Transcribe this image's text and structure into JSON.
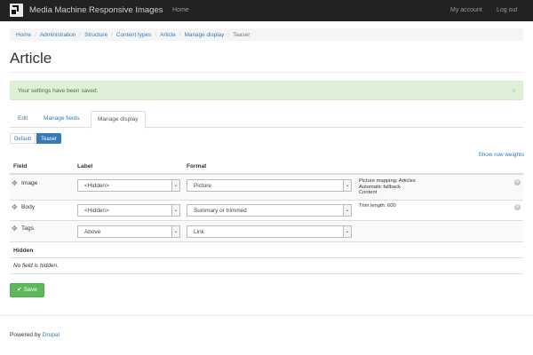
{
  "navbar": {
    "brand": "Media Machine Responsive Images",
    "home": "Home",
    "my_account": "My account",
    "log_out": "Log out",
    "background": "#222222"
  },
  "breadcrumb": [
    "Home",
    "Administration",
    "Structure",
    "Content types",
    "Article",
    "Manage display",
    "Teaser"
  ],
  "page_title": "Article",
  "alert": {
    "message": "Your settings have been saved.",
    "close": "×"
  },
  "tabs": [
    {
      "label": "Edit",
      "active": false
    },
    {
      "label": "Manage fields",
      "active": false
    },
    {
      "label": "Manage display",
      "active": true
    }
  ],
  "view_modes": [
    {
      "label": "Default",
      "active": false
    },
    {
      "label": "Teaser",
      "active": true
    }
  ],
  "row_weights_link": "Show row weights",
  "table": {
    "headers": [
      "Field",
      "Label",
      "Format"
    ],
    "rows": [
      {
        "field": "Image",
        "label": "<Hidden>",
        "format": "Picture",
        "summary": [
          "Picture mapping: Articles",
          "Automatic fallback",
          "Content"
        ],
        "has_settings": true
      },
      {
        "field": "Body",
        "label": "<Hidden>",
        "format": "Summary or trimmed",
        "summary": [
          "Trim length: 600"
        ],
        "has_settings": true
      },
      {
        "field": "Tags",
        "label": "Above",
        "format": "Link",
        "summary": [],
        "has_settings": false
      }
    ],
    "hidden_region": "Hidden",
    "hidden_empty": "No field is hidden."
  },
  "save_button": "Save",
  "footer": {
    "prefix": "Powered by ",
    "link": "Drupal"
  },
  "colors": {
    "link": "#337ab7",
    "success_bg": "#dff0d8",
    "success_text": "#3c763d",
    "save_button": "#5cb85c"
  }
}
